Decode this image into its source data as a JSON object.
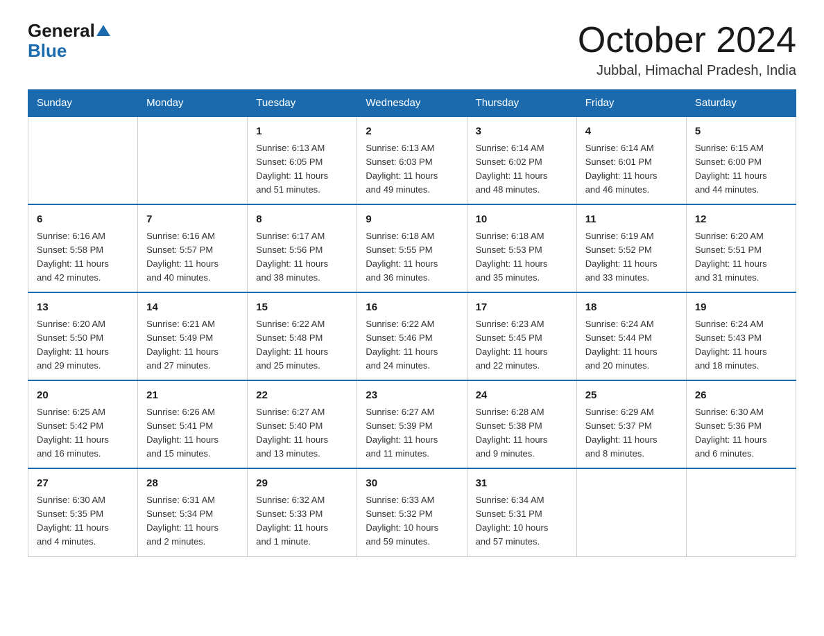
{
  "header": {
    "logo_general": "General",
    "logo_blue": "Blue",
    "month_title": "October 2024",
    "location": "Jubbal, Himachal Pradesh, India"
  },
  "days_of_week": [
    "Sunday",
    "Monday",
    "Tuesday",
    "Wednesday",
    "Thursday",
    "Friday",
    "Saturday"
  ],
  "weeks": [
    [
      {
        "day": "",
        "info": ""
      },
      {
        "day": "",
        "info": ""
      },
      {
        "day": "1",
        "info": "Sunrise: 6:13 AM\nSunset: 6:05 PM\nDaylight: 11 hours\nand 51 minutes."
      },
      {
        "day": "2",
        "info": "Sunrise: 6:13 AM\nSunset: 6:03 PM\nDaylight: 11 hours\nand 49 minutes."
      },
      {
        "day": "3",
        "info": "Sunrise: 6:14 AM\nSunset: 6:02 PM\nDaylight: 11 hours\nand 48 minutes."
      },
      {
        "day": "4",
        "info": "Sunrise: 6:14 AM\nSunset: 6:01 PM\nDaylight: 11 hours\nand 46 minutes."
      },
      {
        "day": "5",
        "info": "Sunrise: 6:15 AM\nSunset: 6:00 PM\nDaylight: 11 hours\nand 44 minutes."
      }
    ],
    [
      {
        "day": "6",
        "info": "Sunrise: 6:16 AM\nSunset: 5:58 PM\nDaylight: 11 hours\nand 42 minutes."
      },
      {
        "day": "7",
        "info": "Sunrise: 6:16 AM\nSunset: 5:57 PM\nDaylight: 11 hours\nand 40 minutes."
      },
      {
        "day": "8",
        "info": "Sunrise: 6:17 AM\nSunset: 5:56 PM\nDaylight: 11 hours\nand 38 minutes."
      },
      {
        "day": "9",
        "info": "Sunrise: 6:18 AM\nSunset: 5:55 PM\nDaylight: 11 hours\nand 36 minutes."
      },
      {
        "day": "10",
        "info": "Sunrise: 6:18 AM\nSunset: 5:53 PM\nDaylight: 11 hours\nand 35 minutes."
      },
      {
        "day": "11",
        "info": "Sunrise: 6:19 AM\nSunset: 5:52 PM\nDaylight: 11 hours\nand 33 minutes."
      },
      {
        "day": "12",
        "info": "Sunrise: 6:20 AM\nSunset: 5:51 PM\nDaylight: 11 hours\nand 31 minutes."
      }
    ],
    [
      {
        "day": "13",
        "info": "Sunrise: 6:20 AM\nSunset: 5:50 PM\nDaylight: 11 hours\nand 29 minutes."
      },
      {
        "day": "14",
        "info": "Sunrise: 6:21 AM\nSunset: 5:49 PM\nDaylight: 11 hours\nand 27 minutes."
      },
      {
        "day": "15",
        "info": "Sunrise: 6:22 AM\nSunset: 5:48 PM\nDaylight: 11 hours\nand 25 minutes."
      },
      {
        "day": "16",
        "info": "Sunrise: 6:22 AM\nSunset: 5:46 PM\nDaylight: 11 hours\nand 24 minutes."
      },
      {
        "day": "17",
        "info": "Sunrise: 6:23 AM\nSunset: 5:45 PM\nDaylight: 11 hours\nand 22 minutes."
      },
      {
        "day": "18",
        "info": "Sunrise: 6:24 AM\nSunset: 5:44 PM\nDaylight: 11 hours\nand 20 minutes."
      },
      {
        "day": "19",
        "info": "Sunrise: 6:24 AM\nSunset: 5:43 PM\nDaylight: 11 hours\nand 18 minutes."
      }
    ],
    [
      {
        "day": "20",
        "info": "Sunrise: 6:25 AM\nSunset: 5:42 PM\nDaylight: 11 hours\nand 16 minutes."
      },
      {
        "day": "21",
        "info": "Sunrise: 6:26 AM\nSunset: 5:41 PM\nDaylight: 11 hours\nand 15 minutes."
      },
      {
        "day": "22",
        "info": "Sunrise: 6:27 AM\nSunset: 5:40 PM\nDaylight: 11 hours\nand 13 minutes."
      },
      {
        "day": "23",
        "info": "Sunrise: 6:27 AM\nSunset: 5:39 PM\nDaylight: 11 hours\nand 11 minutes."
      },
      {
        "day": "24",
        "info": "Sunrise: 6:28 AM\nSunset: 5:38 PM\nDaylight: 11 hours\nand 9 minutes."
      },
      {
        "day": "25",
        "info": "Sunrise: 6:29 AM\nSunset: 5:37 PM\nDaylight: 11 hours\nand 8 minutes."
      },
      {
        "day": "26",
        "info": "Sunrise: 6:30 AM\nSunset: 5:36 PM\nDaylight: 11 hours\nand 6 minutes."
      }
    ],
    [
      {
        "day": "27",
        "info": "Sunrise: 6:30 AM\nSunset: 5:35 PM\nDaylight: 11 hours\nand 4 minutes."
      },
      {
        "day": "28",
        "info": "Sunrise: 6:31 AM\nSunset: 5:34 PM\nDaylight: 11 hours\nand 2 minutes."
      },
      {
        "day": "29",
        "info": "Sunrise: 6:32 AM\nSunset: 5:33 PM\nDaylight: 11 hours\nand 1 minute."
      },
      {
        "day": "30",
        "info": "Sunrise: 6:33 AM\nSunset: 5:32 PM\nDaylight: 10 hours\nand 59 minutes."
      },
      {
        "day": "31",
        "info": "Sunrise: 6:34 AM\nSunset: 5:31 PM\nDaylight: 10 hours\nand 57 minutes."
      },
      {
        "day": "",
        "info": ""
      },
      {
        "day": "",
        "info": ""
      }
    ]
  ]
}
